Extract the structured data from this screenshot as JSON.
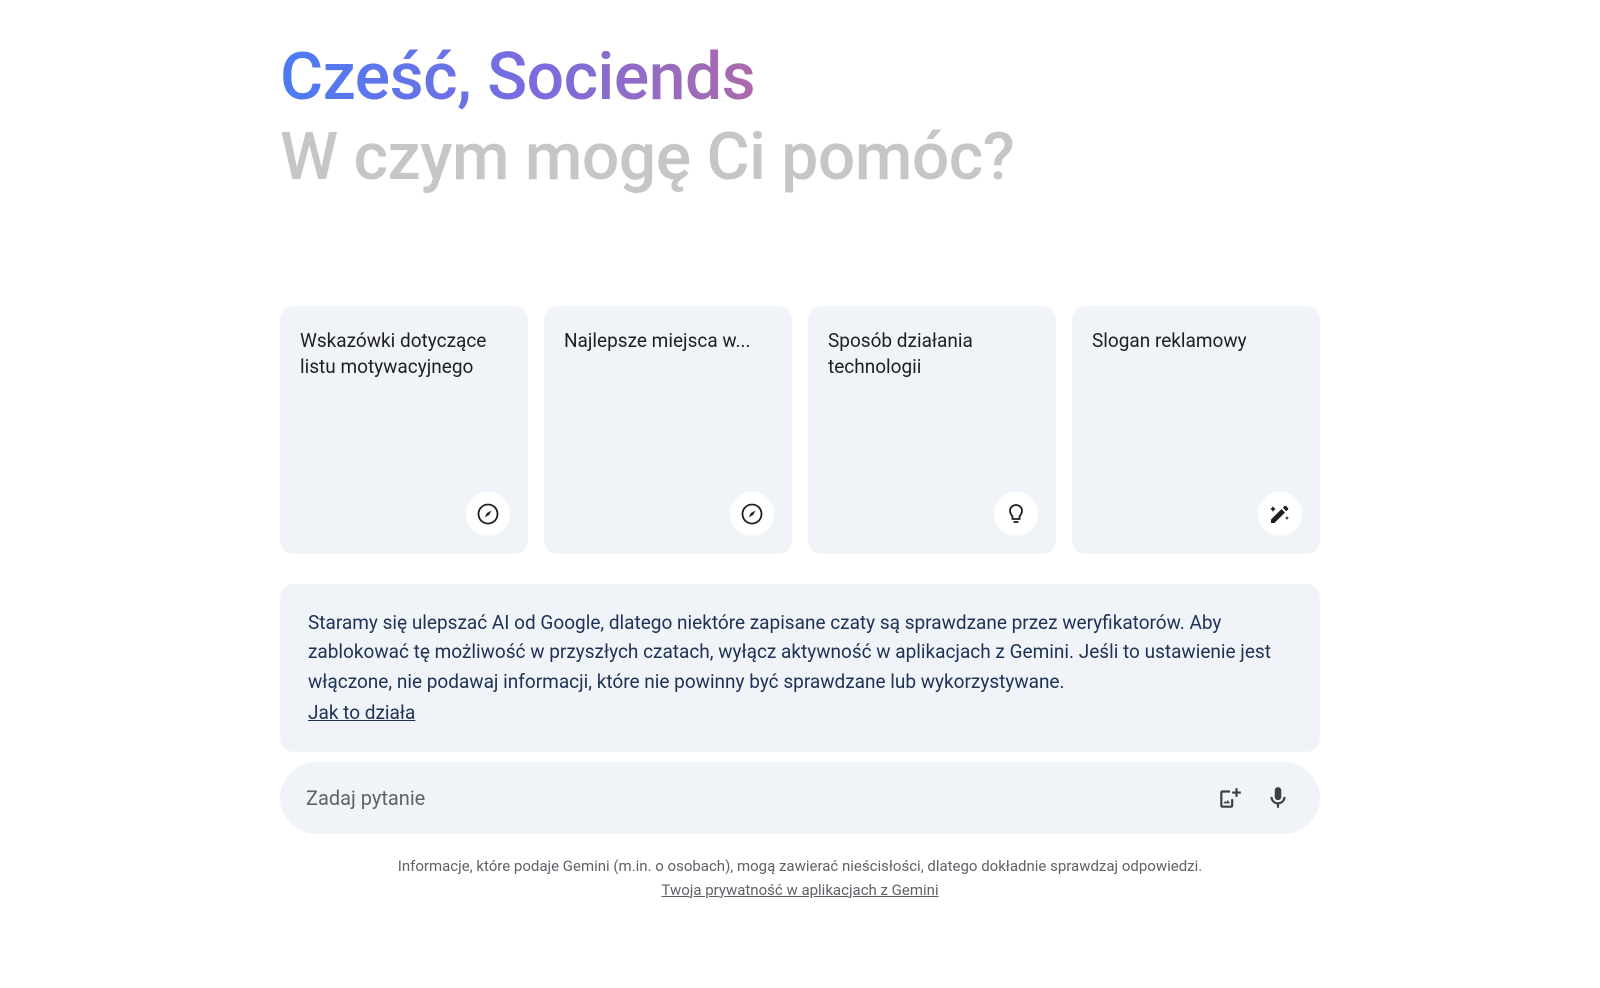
{
  "header": {
    "greeting": "Cześć, Sociends",
    "subtitle": "W czym mogę Ci pomóc?"
  },
  "cards": [
    {
      "title": "Wskazówki dotyczące listu motywacyjnego",
      "icon": "compass"
    },
    {
      "title": "Najlepsze miejsca w...",
      "icon": "compass"
    },
    {
      "title": "Sposób działania technologii",
      "icon": "lightbulb"
    },
    {
      "title": "Slogan reklamowy",
      "icon": "pencil"
    }
  ],
  "notice": {
    "text": "Staramy się ulepszać AI od Google, dlatego niektóre zapisane czaty są sprawdzane przez weryfikatorów. Aby zablokować tę możliwość w przyszłych czatach, wyłącz aktywność w aplikacjach z Gemini. Jeśli to ustawienie jest włączone, nie podawaj informacji, które nie powinny być sprawdzane lub wykorzystywane.",
    "link": "Jak to działa"
  },
  "input": {
    "placeholder": "Zadaj pytanie"
  },
  "footer": {
    "disclaimer": "Informacje, które podaje Gemini (m.in. o osobach), mogą zawierać nieścisłości, dlatego dokładnie sprawdzaj odpowiedzi.",
    "privacy_link": "Twoja prywatność w aplikacjach z Gemini"
  }
}
